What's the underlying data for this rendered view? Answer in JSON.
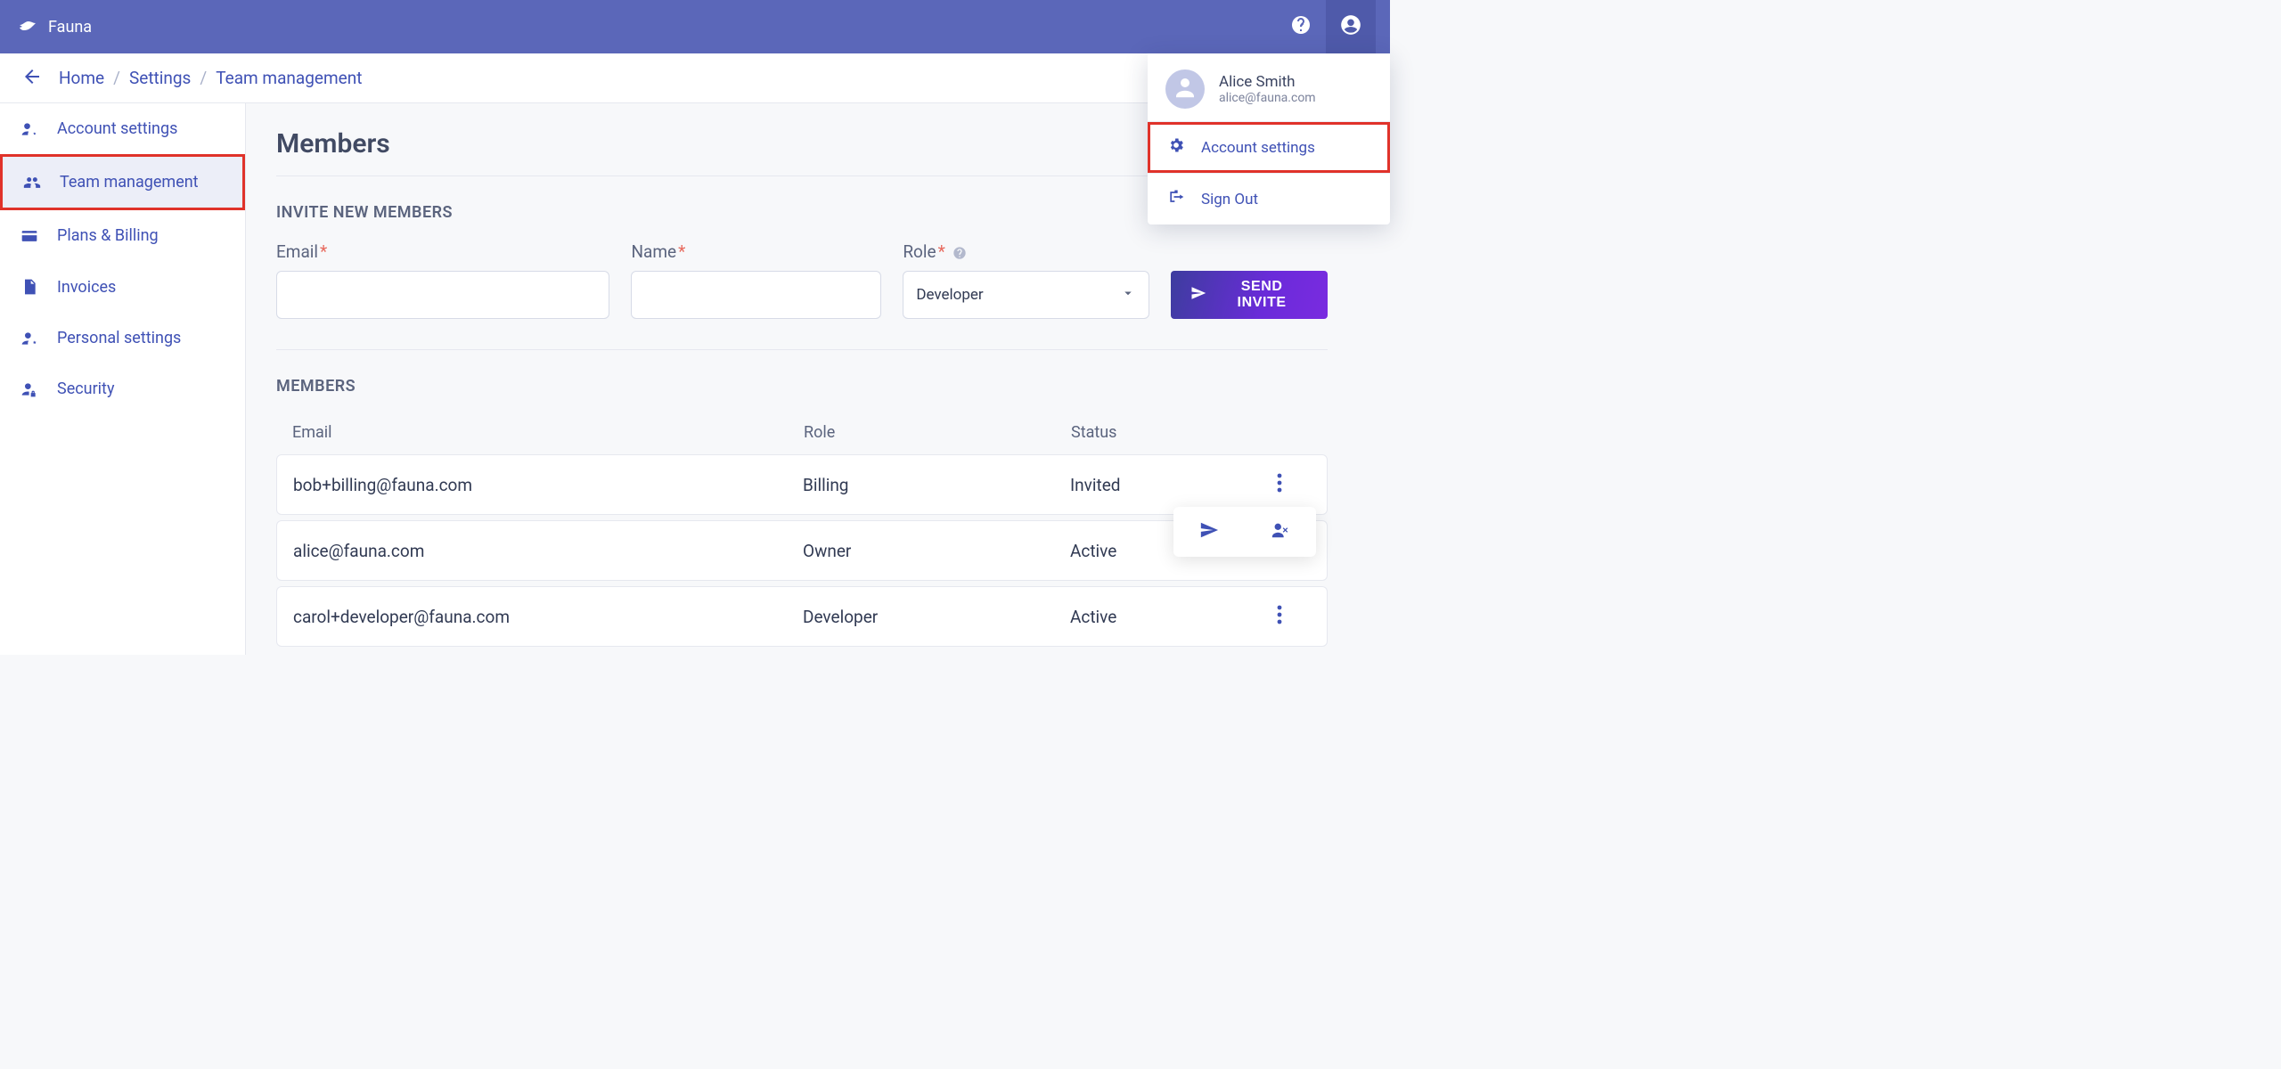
{
  "brand": "Fauna",
  "breadcrumb": {
    "home": "Home",
    "settings": "Settings",
    "current": "Team management"
  },
  "sidebar": {
    "items": [
      {
        "label": "Account settings"
      },
      {
        "label": "Team management"
      },
      {
        "label": "Plans & Billing"
      },
      {
        "label": "Invoices"
      },
      {
        "label": "Personal settings"
      },
      {
        "label": "Security"
      }
    ]
  },
  "page": {
    "title": "Members",
    "invite_section_label": "INVITE NEW MEMBERS",
    "members_section_label": "MEMBERS"
  },
  "invite": {
    "email_label": "Email",
    "name_label": "Name",
    "role_label": "Role",
    "selected_role": "Developer",
    "send_button": "SEND INVITE"
  },
  "table": {
    "headers": {
      "email": "Email",
      "role": "Role",
      "status": "Status"
    },
    "rows": [
      {
        "email": "bob+billing@fauna.com",
        "role": "Billing",
        "status": "Invited"
      },
      {
        "email": "alice@fauna.com",
        "role": "Owner",
        "status": "Active"
      },
      {
        "email": "carol+developer@fauna.com",
        "role": "Developer",
        "status": "Active"
      }
    ]
  },
  "account_menu": {
    "name": "Alice Smith",
    "email": "alice@fauna.com",
    "item_settings": "Account settings",
    "item_signout": "Sign Out"
  }
}
